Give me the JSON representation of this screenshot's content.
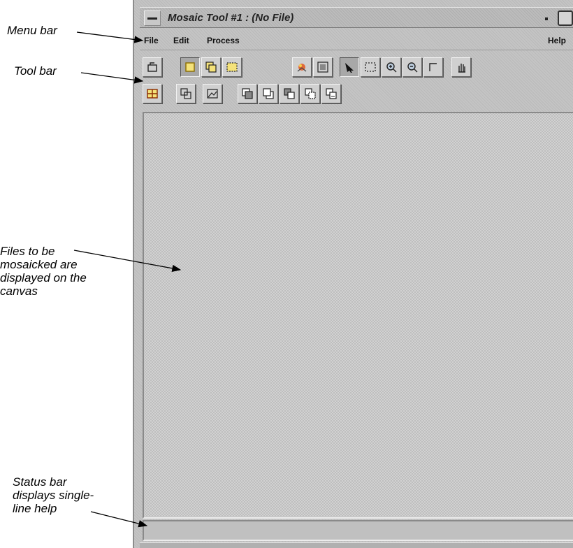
{
  "window": {
    "title": "Mosaic Tool #1 : (No File)"
  },
  "menubar": {
    "items": [
      {
        "label": "File"
      },
      {
        "label": "Edit"
      },
      {
        "label": "Process"
      },
      {
        "label": "Help"
      }
    ]
  },
  "toolbar": {
    "row1": [
      {
        "icon": "open-file-icon",
        "pressed": false
      },
      {
        "icon": "single-frame-icon",
        "pressed": true
      },
      {
        "icon": "two-frames-icon",
        "pressed": false
      },
      {
        "icon": "dashed-frame-icon",
        "pressed": false
      },
      {
        "icon": "colorful-graphic-icon",
        "pressed": false
      },
      {
        "icon": "fit-view-icon",
        "pressed": false
      },
      {
        "icon": "select-arrow-icon",
        "pressed": true
      },
      {
        "icon": "marquee-select-icon",
        "pressed": false
      },
      {
        "icon": "zoom-in-icon",
        "pressed": false
      },
      {
        "icon": "zoom-out-icon",
        "pressed": false
      },
      {
        "icon": "crop-corner-icon",
        "pressed": false
      },
      {
        "icon": "pan-hand-icon",
        "pressed": false
      }
    ],
    "row2": [
      {
        "icon": "table-grid-icon",
        "pressed": false
      },
      {
        "icon": "overlap-shapes-icon",
        "pressed": false
      },
      {
        "icon": "image-area-icon",
        "pressed": false
      },
      {
        "icon": "bring-front-icon",
        "pressed": false
      },
      {
        "icon": "send-back-icon",
        "pressed": false
      },
      {
        "icon": "bring-forward-icon",
        "pressed": false
      },
      {
        "icon": "send-backward-icon",
        "pressed": false
      },
      {
        "icon": "stack-order-icon",
        "pressed": false
      }
    ]
  },
  "statusbar": {
    "text": ""
  },
  "annotations": {
    "menu_bar": "Menu bar",
    "tool_bar": "Tool bar",
    "files_lines": [
      "Files to be",
      "mosaicked are",
      "displayed on the",
      "canvas"
    ],
    "status_lines": [
      "Status bar",
      "displays single-",
      "line help"
    ]
  }
}
